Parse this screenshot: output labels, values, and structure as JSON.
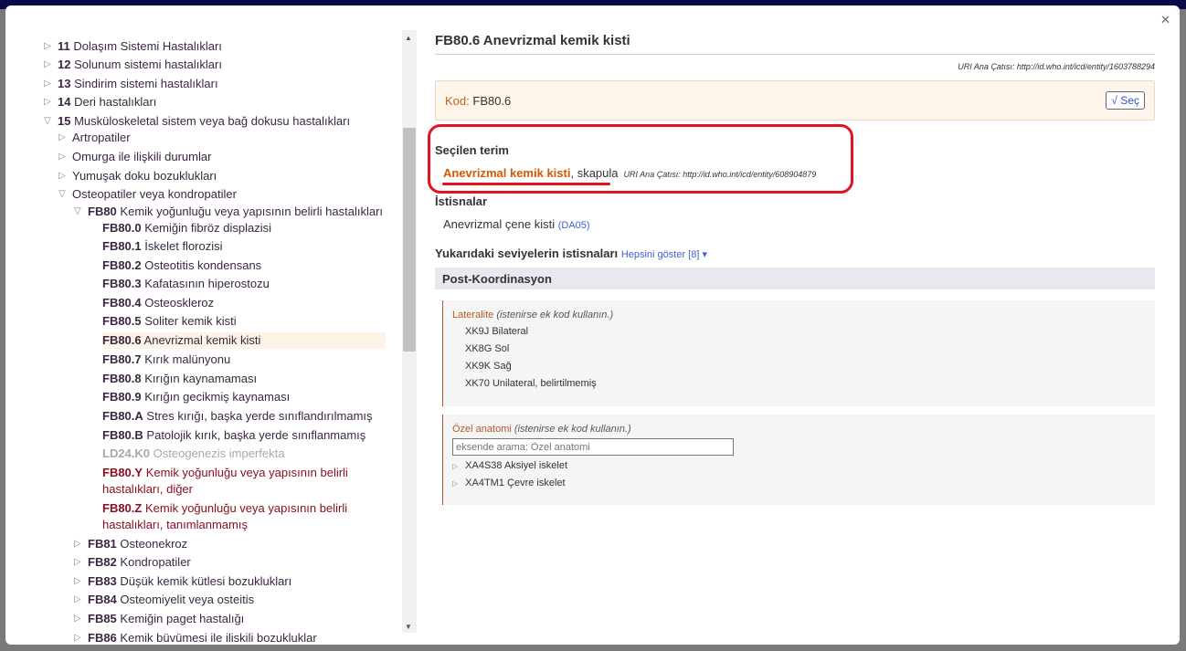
{
  "tree": [
    {
      "code": "11",
      "label": "Dolaşım Sistemi Hastalıkları",
      "state": "collapsed"
    },
    {
      "code": "12",
      "label": "Solunum sistemi hastalıkları",
      "state": "collapsed"
    },
    {
      "code": "13",
      "label": "Sindirim sistemi hastalıkları",
      "state": "collapsed"
    },
    {
      "code": "14",
      "label": "Deri hastalıkları",
      "state": "collapsed"
    },
    {
      "code": "15",
      "label": "Musküloskeletal sistem veya bağ dokusu hastalıkları",
      "state": "expanded"
    },
    {
      "code": "",
      "label": "Artropatiler",
      "state": "collapsed"
    },
    {
      "code": "",
      "label": "Omurga ile ilişkili durumlar",
      "state": "collapsed"
    },
    {
      "code": "",
      "label": "Yumuşak doku bozuklukları",
      "state": "collapsed"
    },
    {
      "code": "",
      "label": "Osteopatiler veya kondropatiler",
      "state": "expanded"
    },
    {
      "code": "FB80",
      "label": "Kemik yoğunluğu veya yapısının belirli hastalıkları",
      "state": "expanded"
    },
    {
      "code": "FB80.0",
      "label": "Kemiğin fibröz displazisi"
    },
    {
      "code": "FB80.1",
      "label": "İskelet florozisi"
    },
    {
      "code": "FB80.2",
      "label": "Osteotitis kondensans"
    },
    {
      "code": "FB80.3",
      "label": "Kafatasının hiperostozu"
    },
    {
      "code": "FB80.4",
      "label": "Osteoskleroz"
    },
    {
      "code": "FB80.5",
      "label": "Soliter kemik kisti"
    },
    {
      "code": "FB80.6",
      "label": "Anevrizmal kemik kisti",
      "selected": true
    },
    {
      "code": "FB80.7",
      "label": "Kırık malünyonu"
    },
    {
      "code": "FB80.8",
      "label": "Kırığın kaynamaması"
    },
    {
      "code": "FB80.9",
      "label": "Kırığın gecikmiş kaynaması"
    },
    {
      "code": "FB80.A",
      "label": "Stres kırığı, başka yerde sınıflandırılmamış"
    },
    {
      "code": "FB80.B",
      "label": "Patolojik kırık, başka yerde sınıflanmamış"
    },
    {
      "code": "LD24.K0",
      "label": "Osteogenezis imperfekta",
      "style": "grey"
    },
    {
      "code": "FB80.Y",
      "label": "Kemik yoğunluğu veya yapısının belirli",
      "label2": "hastalıkları, diğer",
      "style": "red"
    },
    {
      "code": "FB80.Z",
      "label": "Kemik yoğunluğu veya yapısının belirli",
      "label2": "hastalıkları, tanımlanmamış",
      "style": "red"
    },
    {
      "code": "FB81",
      "label": "Osteonekroz",
      "state": "collapsed"
    },
    {
      "code": "FB82",
      "label": "Kondropatiler",
      "state": "collapsed"
    },
    {
      "code": "FB83",
      "label": "Düşük kemik kütlesi bozuklukları",
      "state": "collapsed"
    },
    {
      "code": "FB84",
      "label": "Osteomiyelit veya osteitis",
      "state": "collapsed"
    },
    {
      "code": "FB85",
      "label": "Kemiğin paget hastalığı",
      "state": "collapsed"
    },
    {
      "code": "FB86",
      "label": "Kemik büvümesi ile iliskili bozukluklar",
      "state": "collapsed"
    }
  ],
  "detail": {
    "title": "FB80.6 Anevrizmal kemik kisti",
    "uri": "URI Ana Çatısı: http://id.who.int/icd/entity/1603788294",
    "kod_label": "Kod:",
    "kod_value": "FB80.6",
    "select_button": "√ Seç",
    "selected_term_heading": "Seçilen terim",
    "selected_term_main": "Anevrizmal kemik kisti",
    "selected_term_rest": ", skapula",
    "selected_term_uri": "URI Ana Çatısı: http://id.who.int/icd/entity/608904879",
    "exclusions_heading": "İstisnalar",
    "exclusion_text": "Anevrizmal çene kisti",
    "exclusion_code": "(DA05)",
    "upper_exclusions_heading": "Yukarıdaki seviyelerin istisnaları",
    "show_all": "Hepsini göster [8] ▾",
    "postcoord_heading": "Post-Koordinasyon",
    "laterality": {
      "title": "Lateralite",
      "hint": "(istenirse ek kod kullanın.)",
      "items": [
        "XK9J Bilateral",
        "XK8G Sol",
        "XK9K Sağ",
        "XK70 Unilateral, belirtilmemiş"
      ]
    },
    "anatomy": {
      "title": "Özel anatomi",
      "hint": "(istenirse ek kod kullanın.)",
      "placeholder": "eksende arama: Özel anatomi",
      "items": [
        "XA4S38 Aksiyel iskelet",
        "XA4TM1 Çevre iskelet"
      ]
    }
  },
  "colors": {
    "accent": "#d05a00",
    "highlight": "#e0141e",
    "link": "#4060d0"
  }
}
